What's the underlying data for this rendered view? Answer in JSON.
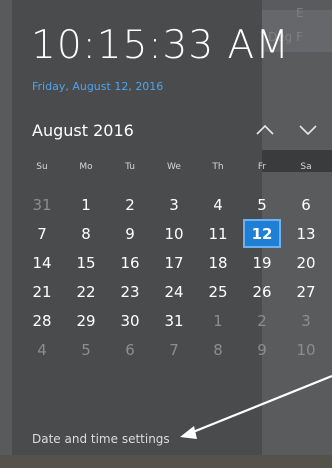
{
  "clock": {
    "time": "10:15:33 AM",
    "date_link": "Friday, August 12, 2016"
  },
  "calendar": {
    "month_title": "August 2016",
    "nav_up_icon": "chevron-up-icon",
    "nav_down_icon": "chevron-down-icon",
    "weekdays": [
      "Su",
      "Mo",
      "Tu",
      "We",
      "Th",
      "Fr",
      "Sa"
    ],
    "days": [
      {
        "label": "31",
        "in_month": false
      },
      {
        "label": "1",
        "in_month": true
      },
      {
        "label": "2",
        "in_month": true
      },
      {
        "label": "3",
        "in_month": true
      },
      {
        "label": "4",
        "in_month": true
      },
      {
        "label": "5",
        "in_month": true
      },
      {
        "label": "6",
        "in_month": true
      },
      {
        "label": "7",
        "in_month": true
      },
      {
        "label": "8",
        "in_month": true
      },
      {
        "label": "9",
        "in_month": true
      },
      {
        "label": "10",
        "in_month": true
      },
      {
        "label": "11",
        "in_month": true
      },
      {
        "label": "12",
        "in_month": true,
        "today": true
      },
      {
        "label": "13",
        "in_month": true
      },
      {
        "label": "14",
        "in_month": true
      },
      {
        "label": "15",
        "in_month": true
      },
      {
        "label": "16",
        "in_month": true
      },
      {
        "label": "17",
        "in_month": true
      },
      {
        "label": "18",
        "in_month": true
      },
      {
        "label": "19",
        "in_month": true
      },
      {
        "label": "20",
        "in_month": true
      },
      {
        "label": "21",
        "in_month": true
      },
      {
        "label": "22",
        "in_month": true
      },
      {
        "label": "23",
        "in_month": true
      },
      {
        "label": "24",
        "in_month": true
      },
      {
        "label": "25",
        "in_month": true
      },
      {
        "label": "26",
        "in_month": true
      },
      {
        "label": "27",
        "in_month": true
      },
      {
        "label": "28",
        "in_month": true
      },
      {
        "label": "29",
        "in_month": true
      },
      {
        "label": "30",
        "in_month": true
      },
      {
        "label": "31",
        "in_month": true
      },
      {
        "label": "1",
        "in_month": false
      },
      {
        "label": "2",
        "in_month": false
      },
      {
        "label": "3",
        "in_month": false
      },
      {
        "label": "4",
        "in_month": false
      },
      {
        "label": "5",
        "in_month": false
      },
      {
        "label": "6",
        "in_month": false
      },
      {
        "label": "7",
        "in_month": false
      },
      {
        "label": "8",
        "in_month": false
      },
      {
        "label": "9",
        "in_month": false
      },
      {
        "label": "10",
        "in_month": false
      }
    ]
  },
  "footer": {
    "settings_link": "Date and time settings"
  },
  "background_window": {
    "text_a": "Deg F",
    "text_b": "E"
  },
  "colors": {
    "accent": "#1f7fd4",
    "link": "#4da3ef",
    "panel": "#4a4b4c",
    "annotation_arrow": "#ffffff"
  },
  "annotation": {
    "icon": "arrow-annotation-icon"
  }
}
